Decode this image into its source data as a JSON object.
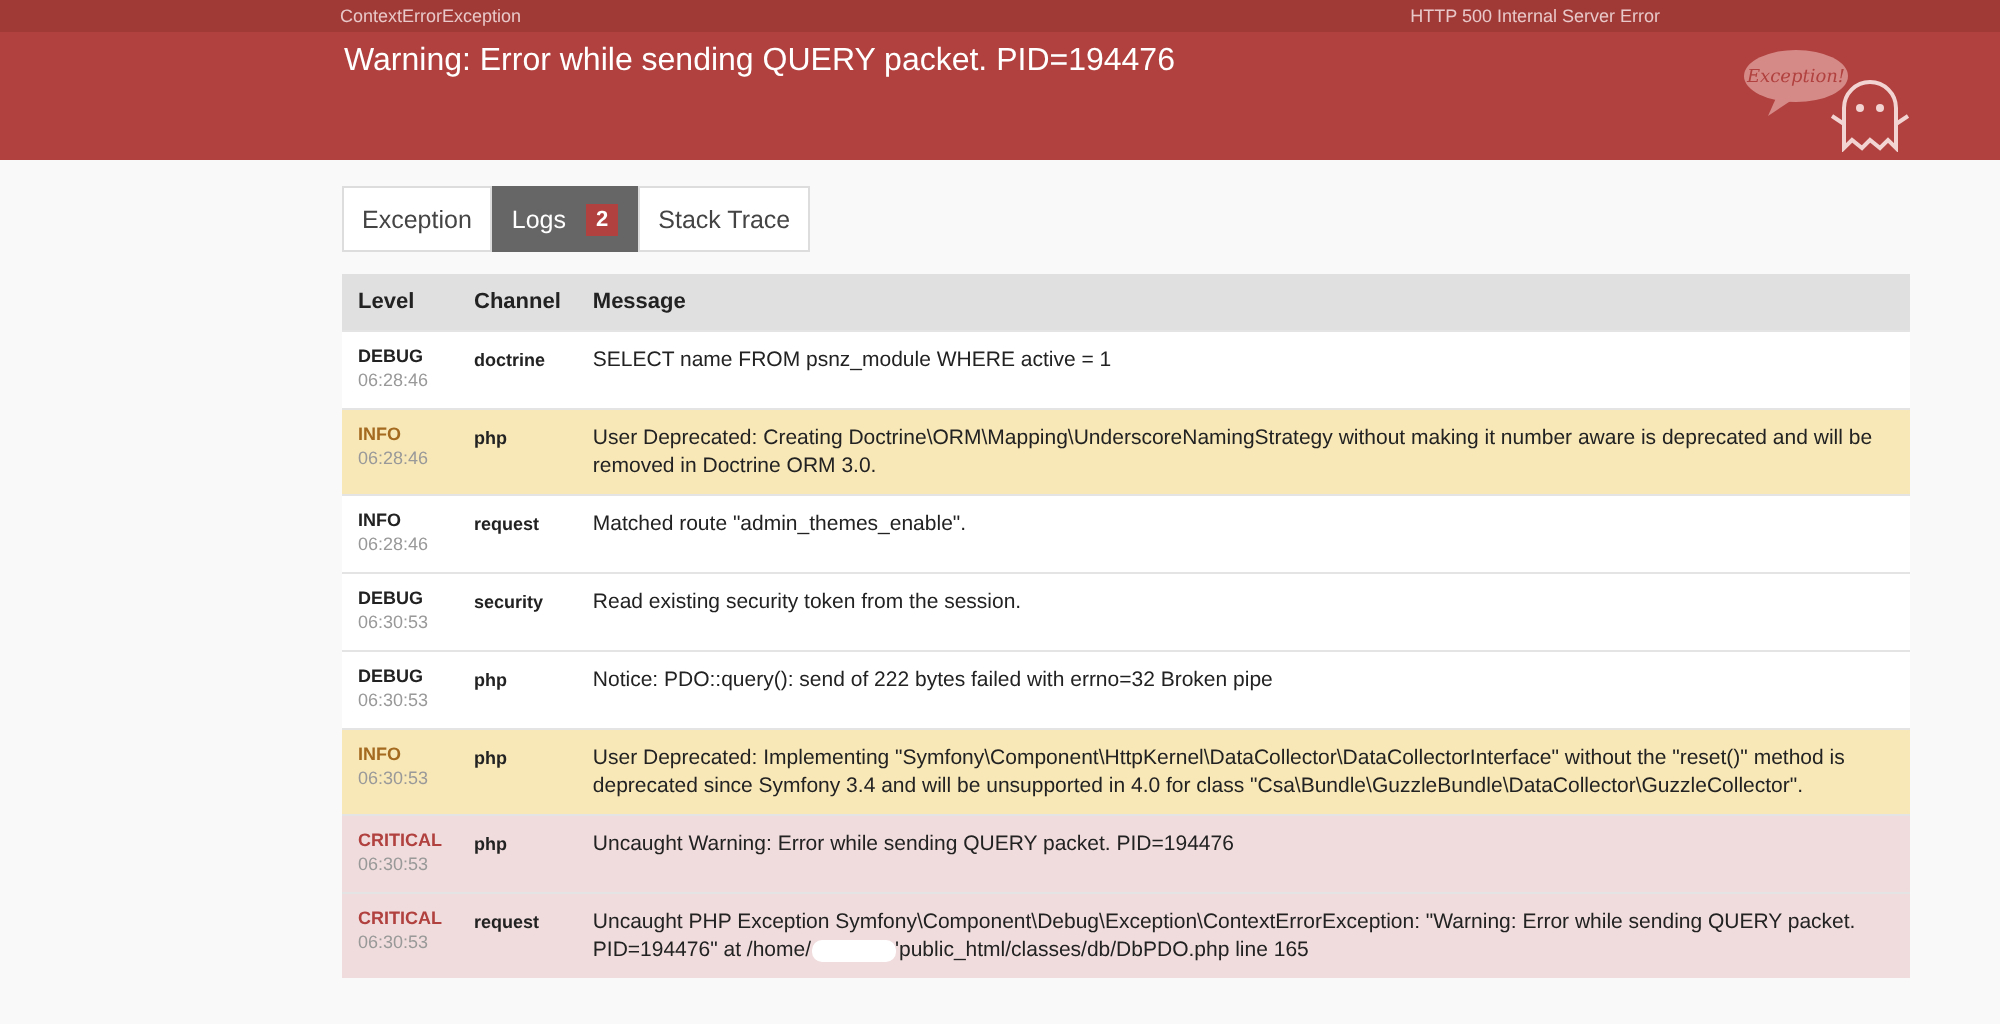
{
  "top_bar": {
    "exception_class": "ContextErrorException",
    "status": "HTTP 500 Internal Server Error"
  },
  "header": {
    "title": "Warning: Error while sending QUERY packet. PID=194476",
    "ghost_caption": "Exception!"
  },
  "tabs": [
    {
      "label": "Exception",
      "selected": false
    },
    {
      "label": "Logs",
      "selected": true,
      "badge": "2"
    },
    {
      "label": "Stack Trace",
      "selected": false
    }
  ],
  "table": {
    "columns": [
      "Level",
      "Channel",
      "Message"
    ],
    "rows": [
      {
        "kind": "debug",
        "level_label": "DEBUG",
        "time": "06:28:46",
        "channel": "doctrine",
        "message": "SELECT name FROM psnz_module WHERE active = 1"
      },
      {
        "kind": "info",
        "level_label": "INFO",
        "time": "06:28:46",
        "channel": "php",
        "message": "User Deprecated: Creating Doctrine\\ORM\\Mapping\\UnderscoreNamingStrategy without making it number aware is deprecated and will be removed in Doctrine ORM 3.0."
      },
      {
        "kind": "plain",
        "level_label": "INFO",
        "time": "06:28:46",
        "channel": "request",
        "message": "Matched route \"admin_themes_enable\"."
      },
      {
        "kind": "debug",
        "level_label": "DEBUG",
        "time": "06:30:53",
        "channel": "security",
        "message": "Read existing security token from the session."
      },
      {
        "kind": "debug",
        "level_label": "DEBUG",
        "time": "06:30:53",
        "channel": "php",
        "message": "Notice: PDO::query(): send of 222 bytes failed with errno=32 Broken pipe"
      },
      {
        "kind": "info",
        "level_label": "INFO",
        "time": "06:30:53",
        "channel": "php",
        "message": "User Deprecated: Implementing \"Symfony\\Component\\HttpKernel\\DataCollector\\DataCollectorInterface\" without the \"reset()\" method is deprecated since Symfony 3.4 and will be unsupported in 4.0 for class \"Csa\\Bundle\\GuzzleBundle\\DataCollector\\GuzzleCollector\"."
      },
      {
        "kind": "critical",
        "level_label": "CRITICAL",
        "time": "06:30:53",
        "channel": "php",
        "message": "Uncaught Warning: Error while sending QUERY packet. PID=194476"
      },
      {
        "kind": "critical",
        "level_label": "CRITICAL",
        "time": "06:30:53",
        "channel": "request",
        "message": "Uncaught PHP Exception Symfony\\Component\\Debug\\Exception\\ContextErrorException: \"Warning: Error while sending QUERY packet. PID=194476\" at /home/",
        "message_after_redaction": "'public_html/classes/db/DbPDO.php line 165"
      }
    ]
  }
}
